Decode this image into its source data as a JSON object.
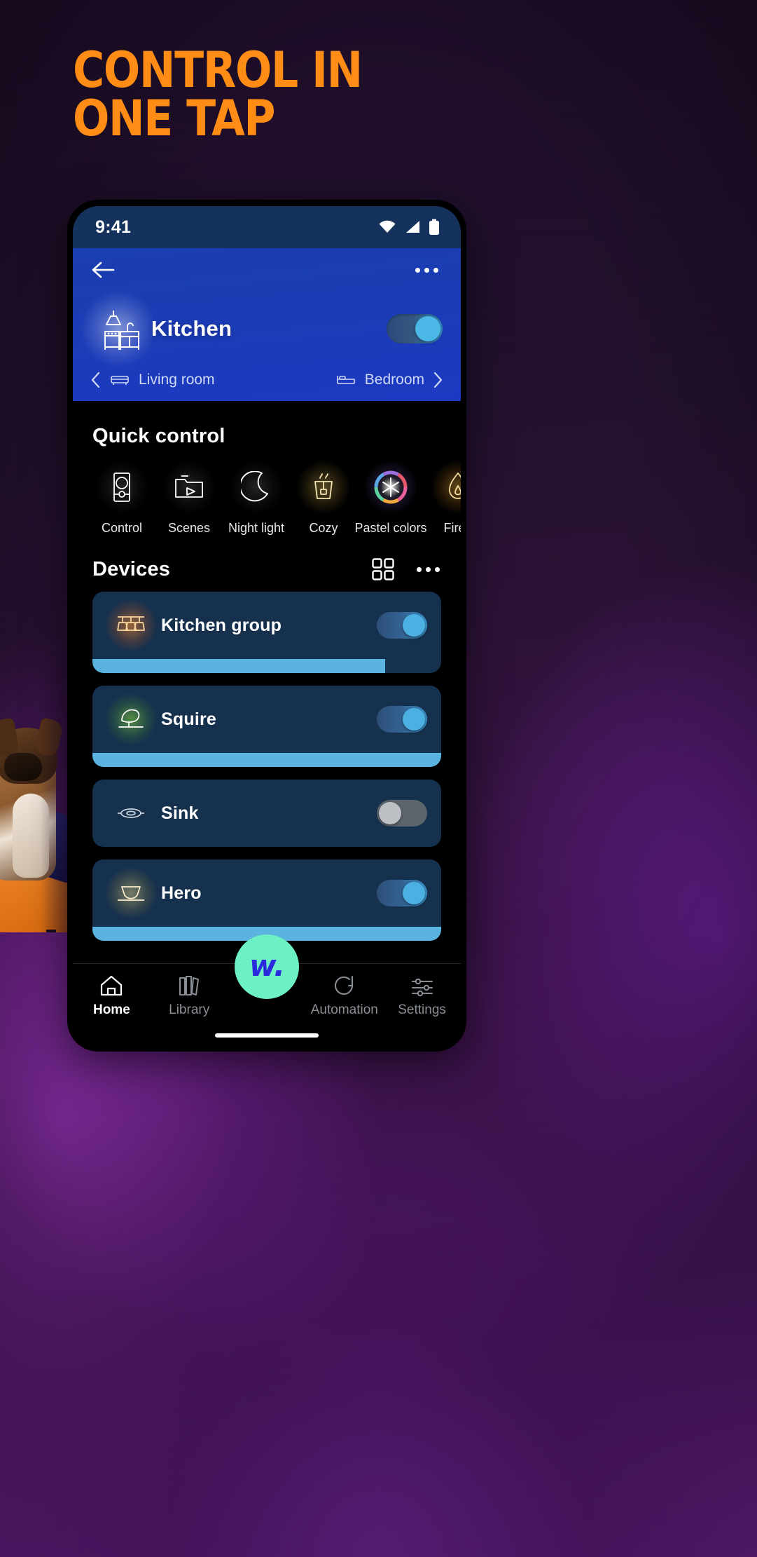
{
  "poster": {
    "headline": "CONTROL IN\nONE TAP",
    "headline_color": "#FF8C14",
    "background_colors": [
      "#1d0c28",
      "#6b1f8e",
      "#9b30d0"
    ]
  },
  "phone": {
    "status_bar": {
      "time": "9:41",
      "background": "#14325c",
      "icons": [
        "wifi-icon",
        "signal-icon",
        "battery-icon"
      ]
    },
    "header": {
      "background": "#1b3cb5",
      "back_icon": "back-arrow-icon",
      "overflow_icon": "more-options-icon",
      "room_icon": "kitchen-icon",
      "room_name": "Kitchen",
      "room_toggle_on": true,
      "prev_room": {
        "label": "Living room",
        "icon": "sofa-icon",
        "chevron": "chevron-left-icon"
      },
      "next_room": {
        "label": "Bedroom",
        "icon": "bed-icon",
        "chevron": "chevron-right-icon"
      }
    },
    "quick_control": {
      "title": "Quick control",
      "items": [
        {
          "label": "Control",
          "icon": "remote-control-icon",
          "glow": "grey"
        },
        {
          "label": "Scenes",
          "icon": "scenes-folder-play-icon",
          "glow": "grey"
        },
        {
          "label": "Night light",
          "icon": "moon-icon",
          "glow": "grey"
        },
        {
          "label": "Cozy",
          "icon": "tea-cup-icon",
          "glow": "warm"
        },
        {
          "label": "Pastel colors",
          "icon": "color-wheel-icon",
          "glow": "rainbow"
        },
        {
          "label": "Firep",
          "icon": "fireplace-icon",
          "glow": "fire"
        }
      ]
    },
    "devices": {
      "title": "Devices",
      "grid_icon": "grid-view-icon",
      "overflow_icon": "more-options-icon",
      "items": [
        {
          "name": "Kitchen group",
          "icon": "pendant-lights-icon",
          "on": true,
          "brightness": 84,
          "glow": "orange"
        },
        {
          "name": "Squire",
          "icon": "table-lamp-icon",
          "on": true,
          "brightness": 100,
          "glow": "green"
        },
        {
          "name": "Sink",
          "icon": "ceiling-light-icon",
          "on": false,
          "brightness": 0,
          "glow": "none"
        },
        {
          "name": "Hero",
          "icon": "wall-light-icon",
          "on": true,
          "brightness": 100,
          "glow": "amber"
        }
      ]
    },
    "bottom_nav": {
      "fab_label": "w.",
      "fab_color": "#6cf0c4",
      "items": [
        {
          "label": "Home",
          "icon": "home-icon",
          "active": true
        },
        {
          "label": "Library",
          "icon": "library-icon",
          "active": false
        },
        {
          "label": "Automation",
          "icon": "automation-icon",
          "active": false
        },
        {
          "label": "Settings",
          "icon": "settings-sliders-icon",
          "active": false
        }
      ]
    }
  }
}
